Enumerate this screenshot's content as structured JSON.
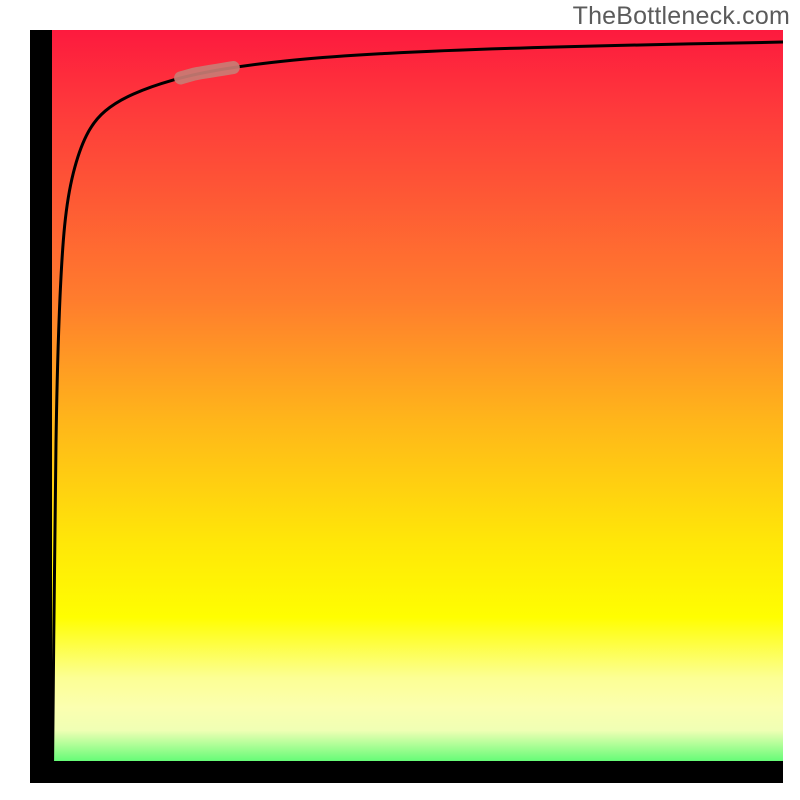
{
  "watermark": "TheBottleneck.com",
  "chart_data": {
    "type": "line",
    "title": "",
    "xlabel": "",
    "ylabel": "",
    "xlim": [
      0,
      100
    ],
    "ylim": [
      0,
      100
    ],
    "series": [
      {
        "name": "curve",
        "x": [
          3.0,
          3.3,
          3.6,
          4.2,
          5.0,
          6.5,
          8.5,
          11.5,
          16.0,
          22.0,
          30.0,
          40.0,
          55.0,
          75.0,
          100.0
        ],
        "values": [
          3.0,
          35.0,
          55.0,
          70.0,
          78.0,
          84.0,
          88.0,
          90.5,
          92.5,
          94.2,
          95.5,
          96.5,
          97.3,
          97.9,
          98.4
        ]
      }
    ],
    "highlight": {
      "series": "curve",
      "x_range": [
        20,
        27
      ]
    },
    "colors": {
      "curve": "#000000",
      "highlight": "#c97c74",
      "axis": "#000000",
      "gradient_stops": [
        "#fd1a3e",
        "#ff7d2d",
        "#ffe708",
        "#fcff94",
        "#0bf84f"
      ]
    }
  }
}
